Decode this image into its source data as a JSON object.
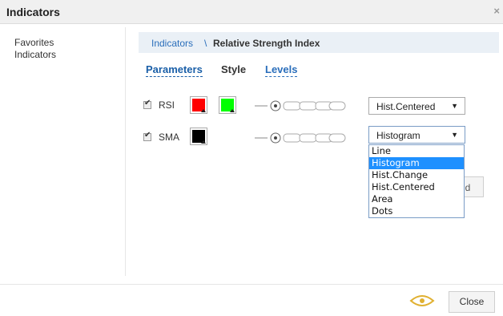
{
  "window": {
    "title": "Indicators",
    "close_symbol": "×"
  },
  "sidebar": {
    "items": [
      {
        "label": "Favorites"
      },
      {
        "label": "Indicators"
      }
    ]
  },
  "breadcrumb": {
    "root": "Indicators",
    "separator": "\\",
    "current": "Relative Strength Index"
  },
  "tabs": [
    {
      "label": "Parameters"
    },
    {
      "label": "Style"
    },
    {
      "label": "Levels"
    }
  ],
  "rows": [
    {
      "label": "RSI",
      "checked": true,
      "colors": [
        "#ff0000",
        "#00ff00"
      ],
      "style": "Hist.Centered"
    },
    {
      "label": "SMA",
      "checked": true,
      "colors": [
        "#000000"
      ],
      "style": "Histogram"
    }
  ],
  "dropdown": {
    "options": [
      "Line",
      "Histogram",
      "Hist.Change",
      "Hist.Centered",
      "Area",
      "Dots"
    ],
    "selected_index": 1
  },
  "partial_button": {
    "label": "ld"
  },
  "footer": {
    "close_label": "Close",
    "eye_color": "#e0b030"
  }
}
